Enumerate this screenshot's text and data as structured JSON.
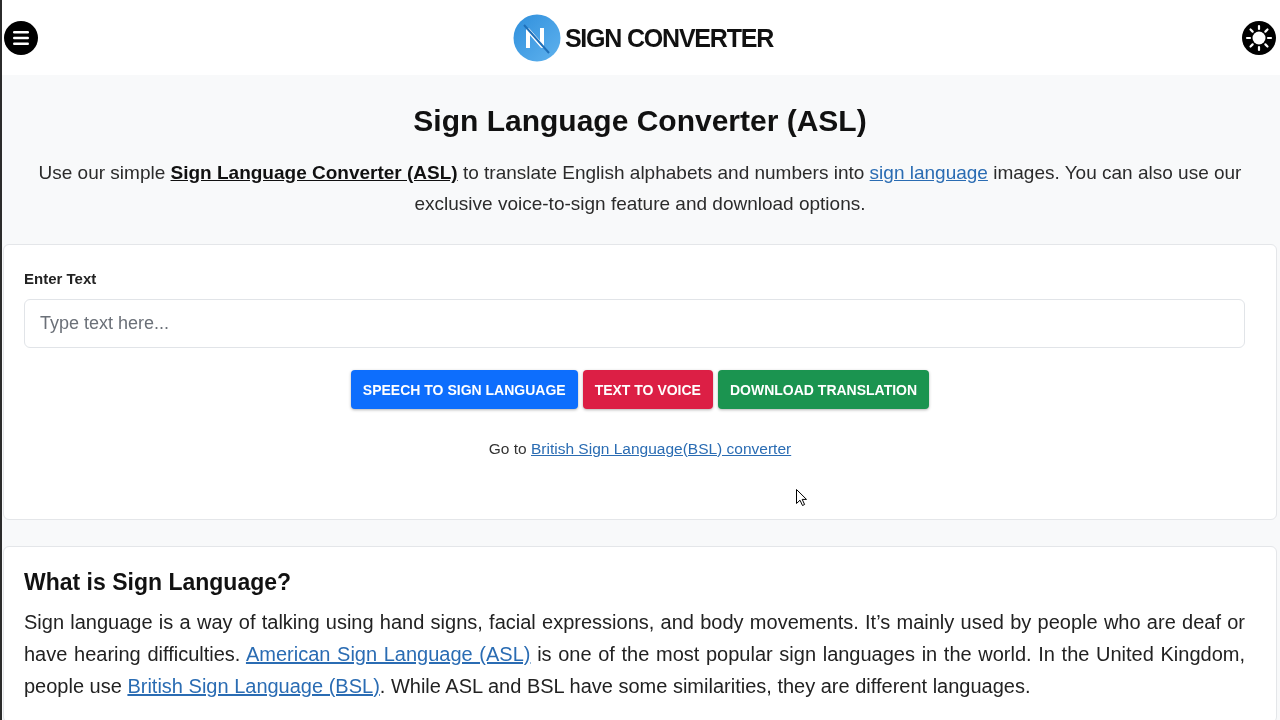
{
  "header": {
    "logo_text": "SIGN CONVERTER"
  },
  "hero": {
    "title": "Sign Language Converter (ASL)",
    "intro": [
      {
        "kind": "text",
        "text": "Use our simple "
      },
      {
        "kind": "strong_link",
        "text": "Sign Language Converter (ASL)"
      },
      {
        "kind": "text",
        "text": " to translate English alphabets and numbers into "
      },
      {
        "kind": "link",
        "text": "sign language"
      },
      {
        "kind": "text",
        "text": " images. You can also use our exclusive voice-to-sign feature and download options."
      }
    ]
  },
  "converter": {
    "label": "Enter Text",
    "input": {
      "placeholder": "Type text here..."
    },
    "buttons": [
      {
        "label": "SPEECH TO SIGN LANGUAGE",
        "kind": "primary"
      },
      {
        "label": "TEXT TO VOICE",
        "kind": "danger"
      },
      {
        "label": "DOWNLOAD TRANSLATION",
        "kind": "success"
      }
    ],
    "note": [
      {
        "kind": "text",
        "text": "Go to "
      },
      {
        "kind": "link",
        "text": "British Sign Language(BSL) converter"
      }
    ]
  },
  "article": {
    "heading": "What is Sign Language?",
    "paragraph": [
      {
        "kind": "text",
        "text": "Sign language is a way of talking using hand signs, facial expressions, and body movements. It’s mainly used by people who are deaf or have hearing difficulties. "
      },
      {
        "kind": "link",
        "text": "American Sign Language (ASL)"
      },
      {
        "kind": "text",
        "text": " is one of the most popular sign languages in the world. In the United Kingdom, people use "
      },
      {
        "kind": "link",
        "text": "British Sign Language (BSL)"
      },
      {
        "kind": "text",
        "text": ". While ASL and BSL have some similarities, they are different languages."
      }
    ]
  }
}
